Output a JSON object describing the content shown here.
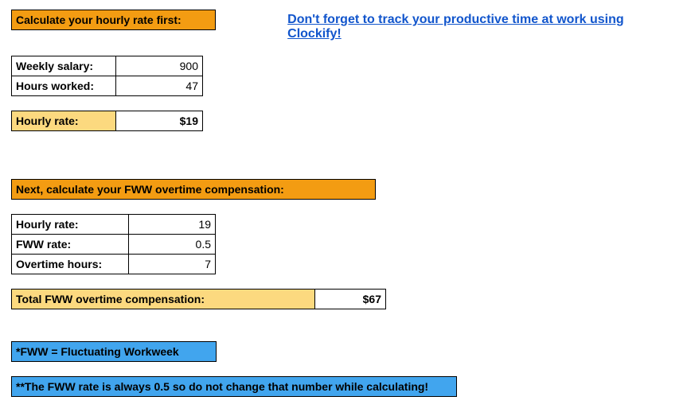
{
  "header1": "Calculate your hourly rate first:",
  "link_text": "Don't forget to track your productive time at work using Clockify!",
  "section1": {
    "rows": [
      {
        "label": "Weekly salary:",
        "value": "900"
      },
      {
        "label": "Hours worked:",
        "value": "47"
      }
    ],
    "result_label": "Hourly rate:",
    "result_value": "$19"
  },
  "header2": "Next, calculate your FWW overtime compensation:",
  "section2": {
    "rows": [
      {
        "label": "Hourly rate:",
        "value": "19"
      },
      {
        "label": "FWW rate:",
        "value": "0.5"
      },
      {
        "label": "Overtime hours:",
        "value": "7"
      }
    ],
    "result_label": "Total FWW overtime compensation:",
    "result_value": "$67"
  },
  "note1": "*FWW = Fluctuating Workweek",
  "note2": "**The FWW rate is always 0.5 so do not change that number while calculating!"
}
